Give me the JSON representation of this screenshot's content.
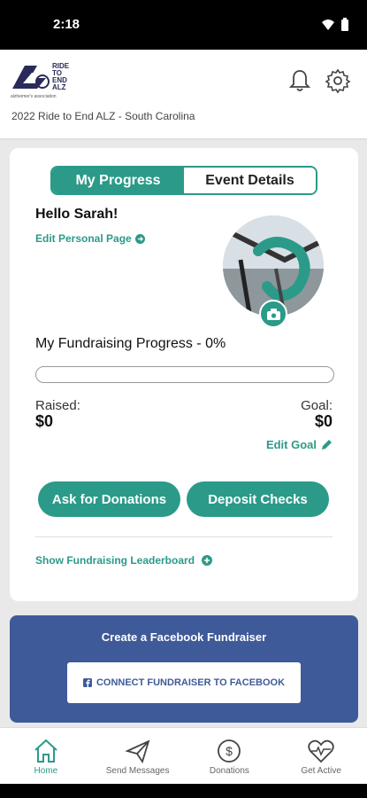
{
  "status": {
    "time": "2:18"
  },
  "header": {
    "logo_lines": [
      "RIDE",
      "TO",
      "END",
      "ALZ"
    ],
    "logo_sub": "alzheimer's association",
    "event_name": "2022 Ride to End ALZ - South Carolina"
  },
  "tabs": [
    {
      "label": "My Progress",
      "active": true
    },
    {
      "label": "Event Details",
      "active": false
    }
  ],
  "profile": {
    "greeting": "Hello Sarah!",
    "edit_page_label": "Edit Personal Page"
  },
  "fundraising": {
    "title": "My Fundraising Progress - 0%",
    "progress_fraction": 0,
    "raised_label": "Raised:",
    "raised_value": "$0",
    "goal_label": "Goal:",
    "goal_value": "$0",
    "edit_goal_label": "Edit Goal"
  },
  "actions": {
    "ask_label": "Ask for Donations",
    "deposit_label": "Deposit Checks",
    "leaderboard_label": "Show Fundraising Leaderboard"
  },
  "facebook": {
    "title": "Create a Facebook Fundraiser",
    "button_label": "CONNECT FUNDRAISER TO FACEBOOK"
  },
  "nav": [
    {
      "label": "Home",
      "icon": "home-icon",
      "active": true
    },
    {
      "label": "Send Messages",
      "icon": "send-icon",
      "active": false
    },
    {
      "label": "Donations",
      "icon": "dollar-icon",
      "active": false
    },
    {
      "label": "Get Active",
      "icon": "heartbeat-icon",
      "active": false
    }
  ],
  "colors": {
    "accent": "#2b9a89",
    "facebook": "#3f5a99"
  }
}
